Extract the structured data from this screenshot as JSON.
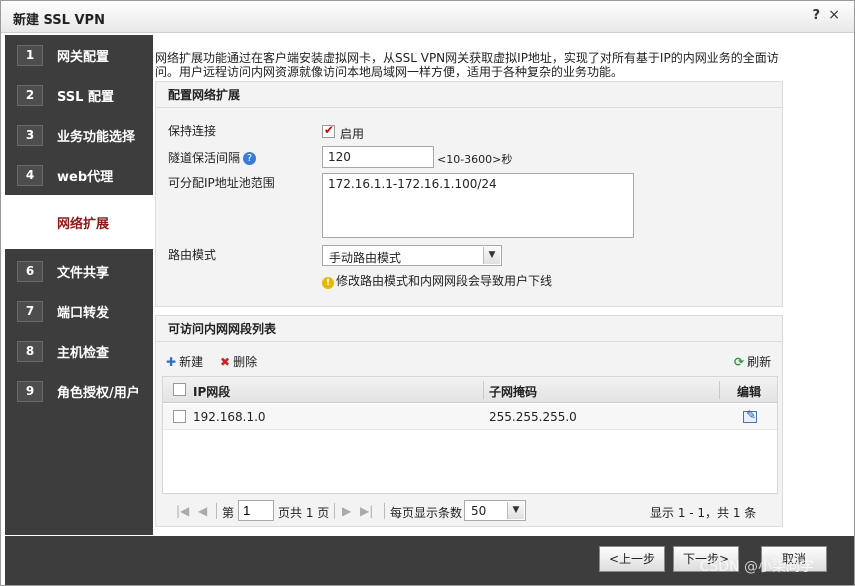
{
  "window": {
    "title": "新建 SSL VPN",
    "help": "?",
    "close": "×"
  },
  "sidebar": {
    "steps": [
      {
        "num": "1",
        "label": "网关配置"
      },
      {
        "num": "2",
        "label": "SSL 配置"
      },
      {
        "num": "3",
        "label": "业务功能选择"
      },
      {
        "num": "4",
        "label": "web代理"
      },
      {
        "num": "5",
        "label": "网络扩展"
      },
      {
        "num": "6",
        "label": "文件共享"
      },
      {
        "num": "7",
        "label": "端口转发"
      },
      {
        "num": "8",
        "label": "主机检查"
      },
      {
        "num": "9",
        "label": "角色授权/用户"
      }
    ]
  },
  "intro": "网络扩展功能通过在客户端安装虚拟网卡，从SSL VPN网关获取虚拟IP地址，实现了对所有基于IP的内网业务的全面访问。用户远程访问内网资源就像访问本地局域网一样方便，适用于各种复杂的业务功能。",
  "config": {
    "title": "配置网络扩展",
    "keepalive_label": "保持连接",
    "keepalive_enable": "启用",
    "interval_label": "隧道保活间隔",
    "interval_value": "120",
    "interval_hint": "<10-3600>秒",
    "pool_label": "可分配IP地址池范围",
    "pool_value": "172.16.1.1-172.16.1.100/24",
    "route_label": "路由模式",
    "route_value": "手动路由模式",
    "route_warning": "修改路由模式和内网网段会导致用户下线"
  },
  "segments": {
    "title": "可访问内网网段列表",
    "new_label": "新建",
    "delete_label": "删除",
    "refresh_label": "刷新",
    "columns": {
      "ip": "IP网段",
      "mask": "子网掩码",
      "edit": "编辑"
    },
    "rows": [
      {
        "ip": "192.168.1.0",
        "mask": "255.255.255.0"
      }
    ],
    "pager": {
      "page_prefix": "第",
      "page_value": "1",
      "page_suffix": "页共 1 页",
      "per_page_label": "每页显示条数",
      "per_page_value": "50",
      "summary": "显示 1 - 1，共 1 条"
    }
  },
  "footer": {
    "prev": "<上一步",
    "next": "下一步>",
    "cancel": "取消",
    "watermark": "CSDN @小柒同学"
  }
}
